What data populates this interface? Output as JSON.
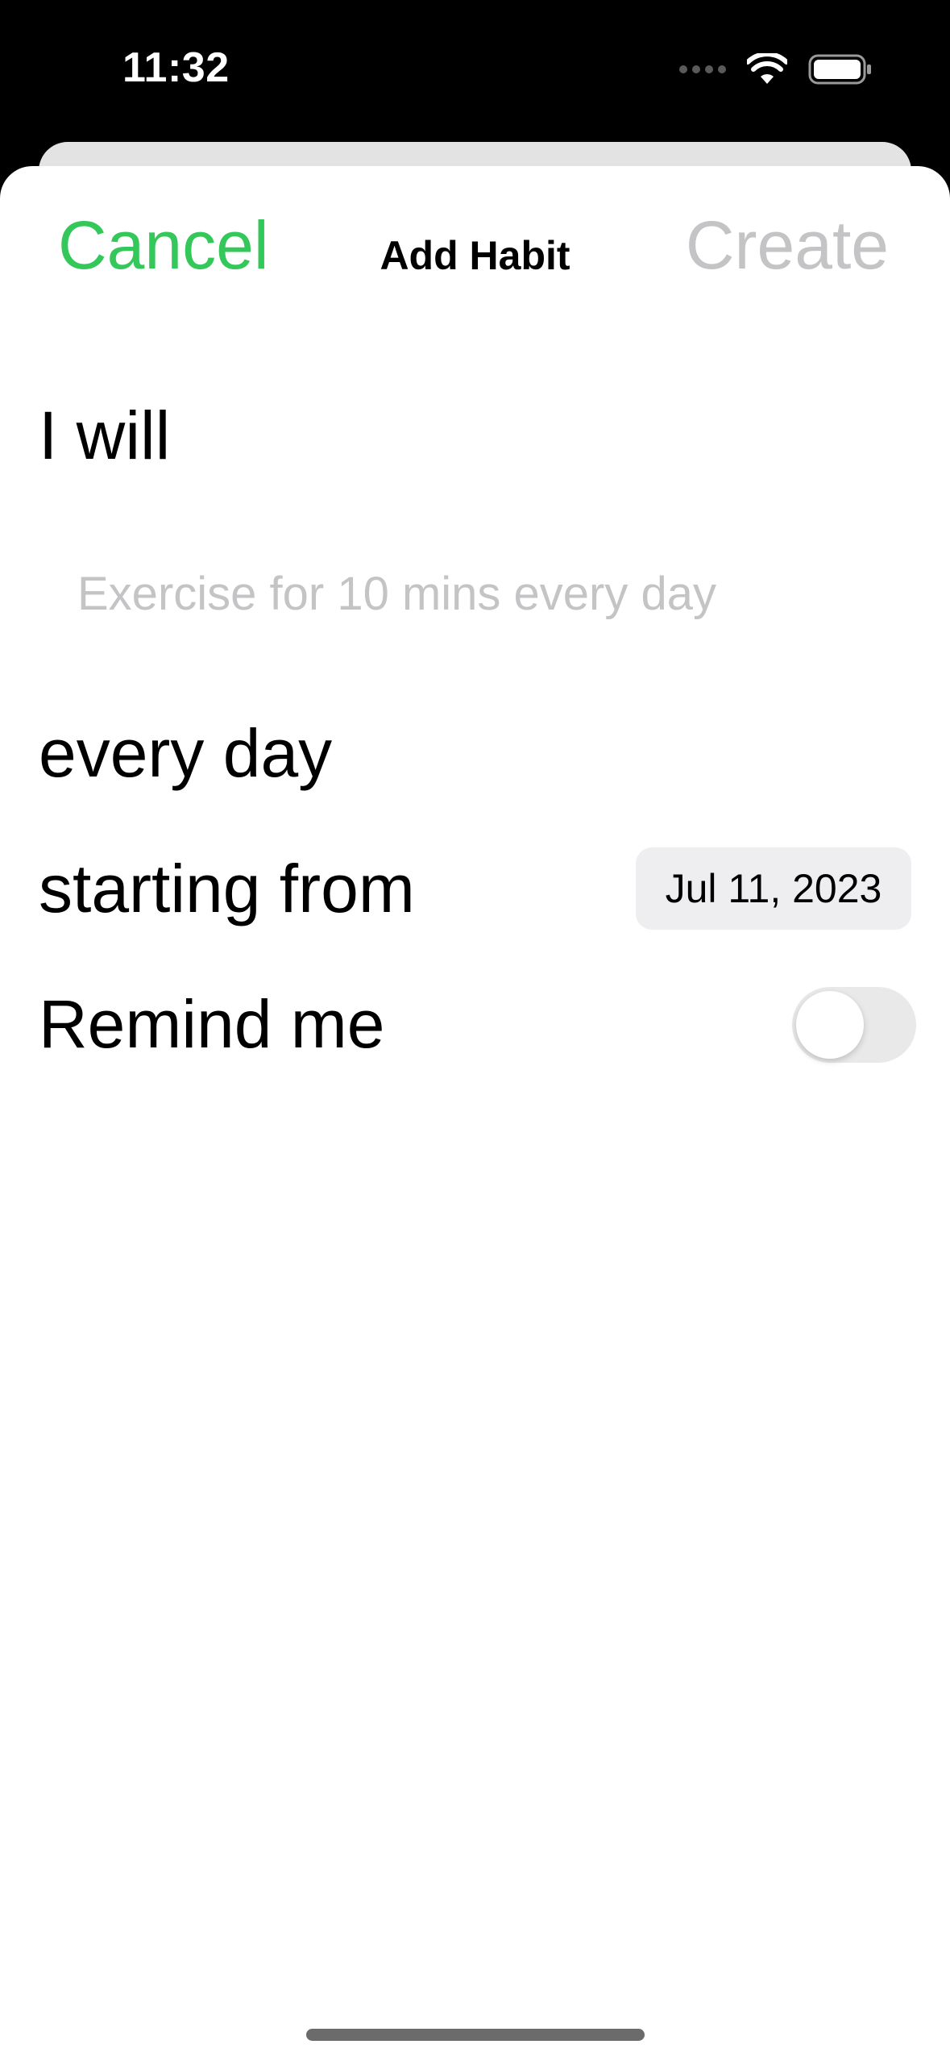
{
  "status_bar": {
    "time": "11:32",
    "icons": [
      "cellular-signal-icon",
      "wifi-icon",
      "battery-icon"
    ]
  },
  "nav": {
    "cancel_label": "Cancel",
    "title": "Add Habit",
    "create_label": "Create"
  },
  "form": {
    "intro_label": "I will",
    "habit_placeholder": "Exercise for 10 mins every day",
    "habit_value": "",
    "frequency_label": "every day",
    "start_label": "starting from",
    "start_date": "Jul 11, 2023",
    "remind_label": "Remind me",
    "remind_enabled": false
  },
  "colors": {
    "accent": "#34c759",
    "disabled": "#c4c4c6",
    "pill_bg": "#eeeef0",
    "toggle_off_bg": "#e9e9ea"
  }
}
